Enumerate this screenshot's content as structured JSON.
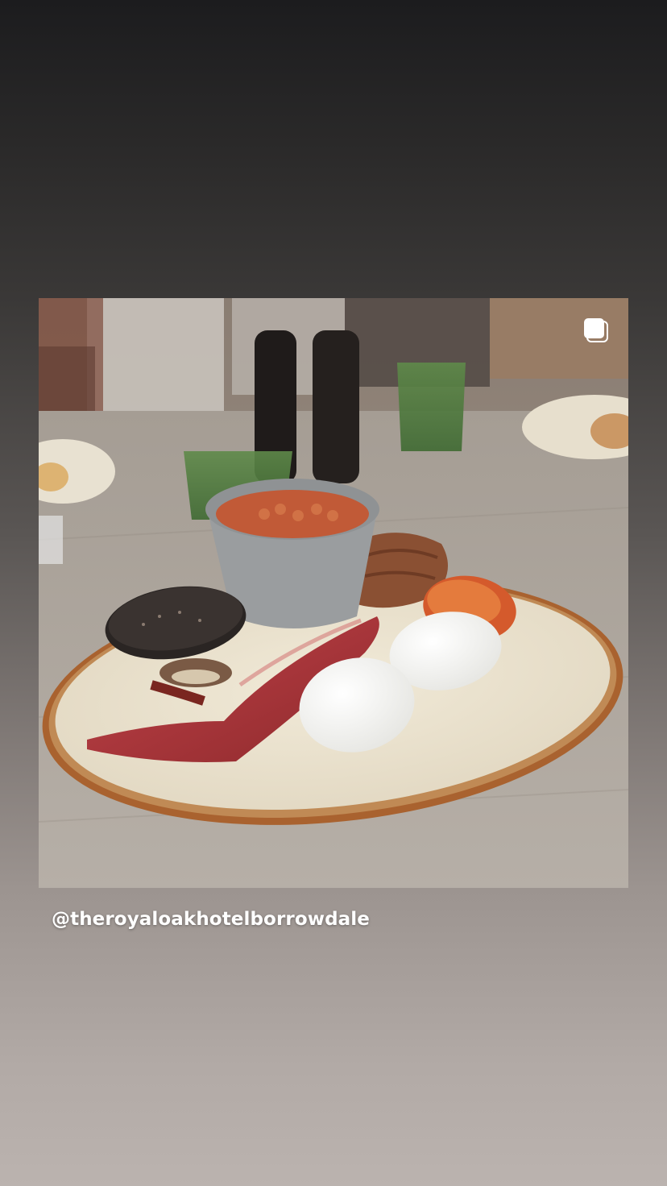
{
  "post": {
    "username": "@theroyaloakhotelborrowdale",
    "media_type_icon": "carousel-multiple-icon",
    "photo_subject": "full-english-breakfast-plate"
  },
  "colors": {
    "background_top": "#1c1c1e",
    "background_bottom": "#bbb3af",
    "username_text": "#ffffff"
  }
}
